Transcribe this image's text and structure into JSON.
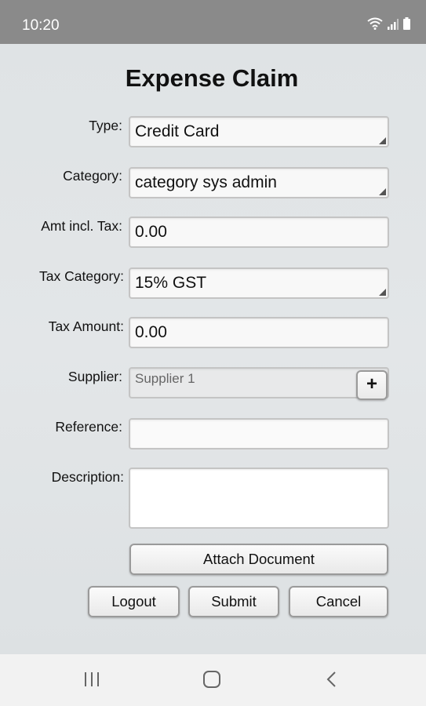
{
  "status_bar": {
    "time": "10:20"
  },
  "form": {
    "title": "Expense Claim",
    "type": {
      "label": "Type:",
      "value": "Credit Card"
    },
    "category": {
      "label": "Category:",
      "value": "category sys admin"
    },
    "amount": {
      "label": "Amt incl. Tax:",
      "value": "0.00"
    },
    "tax_category": {
      "label": "Tax Category:",
      "value": "15% GST"
    },
    "tax_amount": {
      "label": "Tax Amount:",
      "value": "0.00"
    },
    "supplier": {
      "label": "Supplier:",
      "value": "Supplier 1",
      "add_label": "+"
    },
    "reference": {
      "label": "Reference:",
      "value": ""
    },
    "description": {
      "label": "Description:",
      "value": ""
    }
  },
  "buttons": {
    "attach": "Attach Document",
    "logout": "Logout",
    "submit": "Submit",
    "cancel": "Cancel"
  },
  "icons": [
    "wifi-icon",
    "signal-icon",
    "battery-icon",
    "recent-apps-icon",
    "home-icon",
    "back-icon"
  ]
}
